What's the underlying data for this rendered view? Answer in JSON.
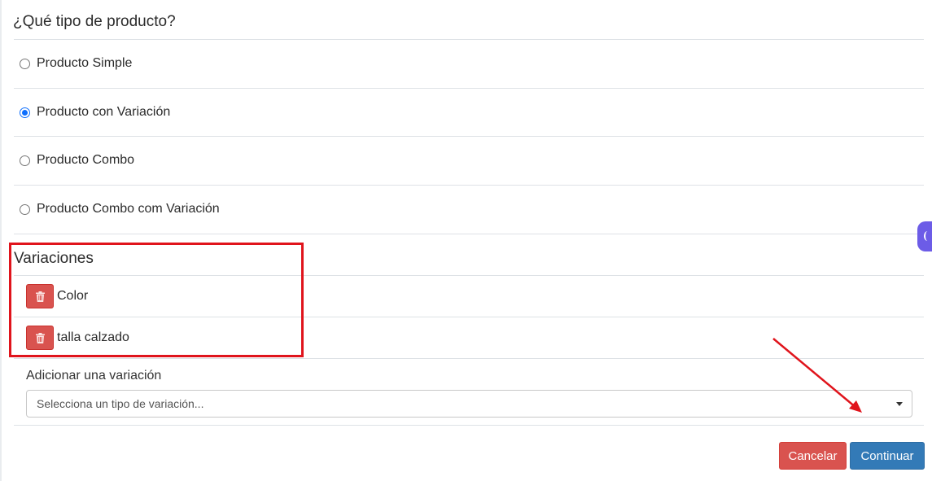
{
  "question": {
    "title": "¿Qué tipo de producto?"
  },
  "product_types": [
    {
      "label": "Producto Simple",
      "checked": false
    },
    {
      "label": "Producto con Variación",
      "checked": true
    },
    {
      "label": "Producto Combo",
      "checked": false
    },
    {
      "label": "Producto Combo com Variación",
      "checked": false
    }
  ],
  "variations": {
    "title": "Variaciones",
    "items": [
      {
        "label": "Color"
      },
      {
        "label": "talla calzado"
      }
    ]
  },
  "add_variation": {
    "label": "Adicionar una variación",
    "placeholder": "Selecciona un tipo de variación..."
  },
  "actions": {
    "cancel": "Cancelar",
    "continue": "Continuar"
  },
  "colors": {
    "danger": "#d9534f",
    "primary": "#337ab7",
    "annotation": "#e0141c",
    "radio_selected": "#0d6efd"
  },
  "icons": [
    "trash-icon",
    "caret-down-icon",
    "radio-icon"
  ]
}
